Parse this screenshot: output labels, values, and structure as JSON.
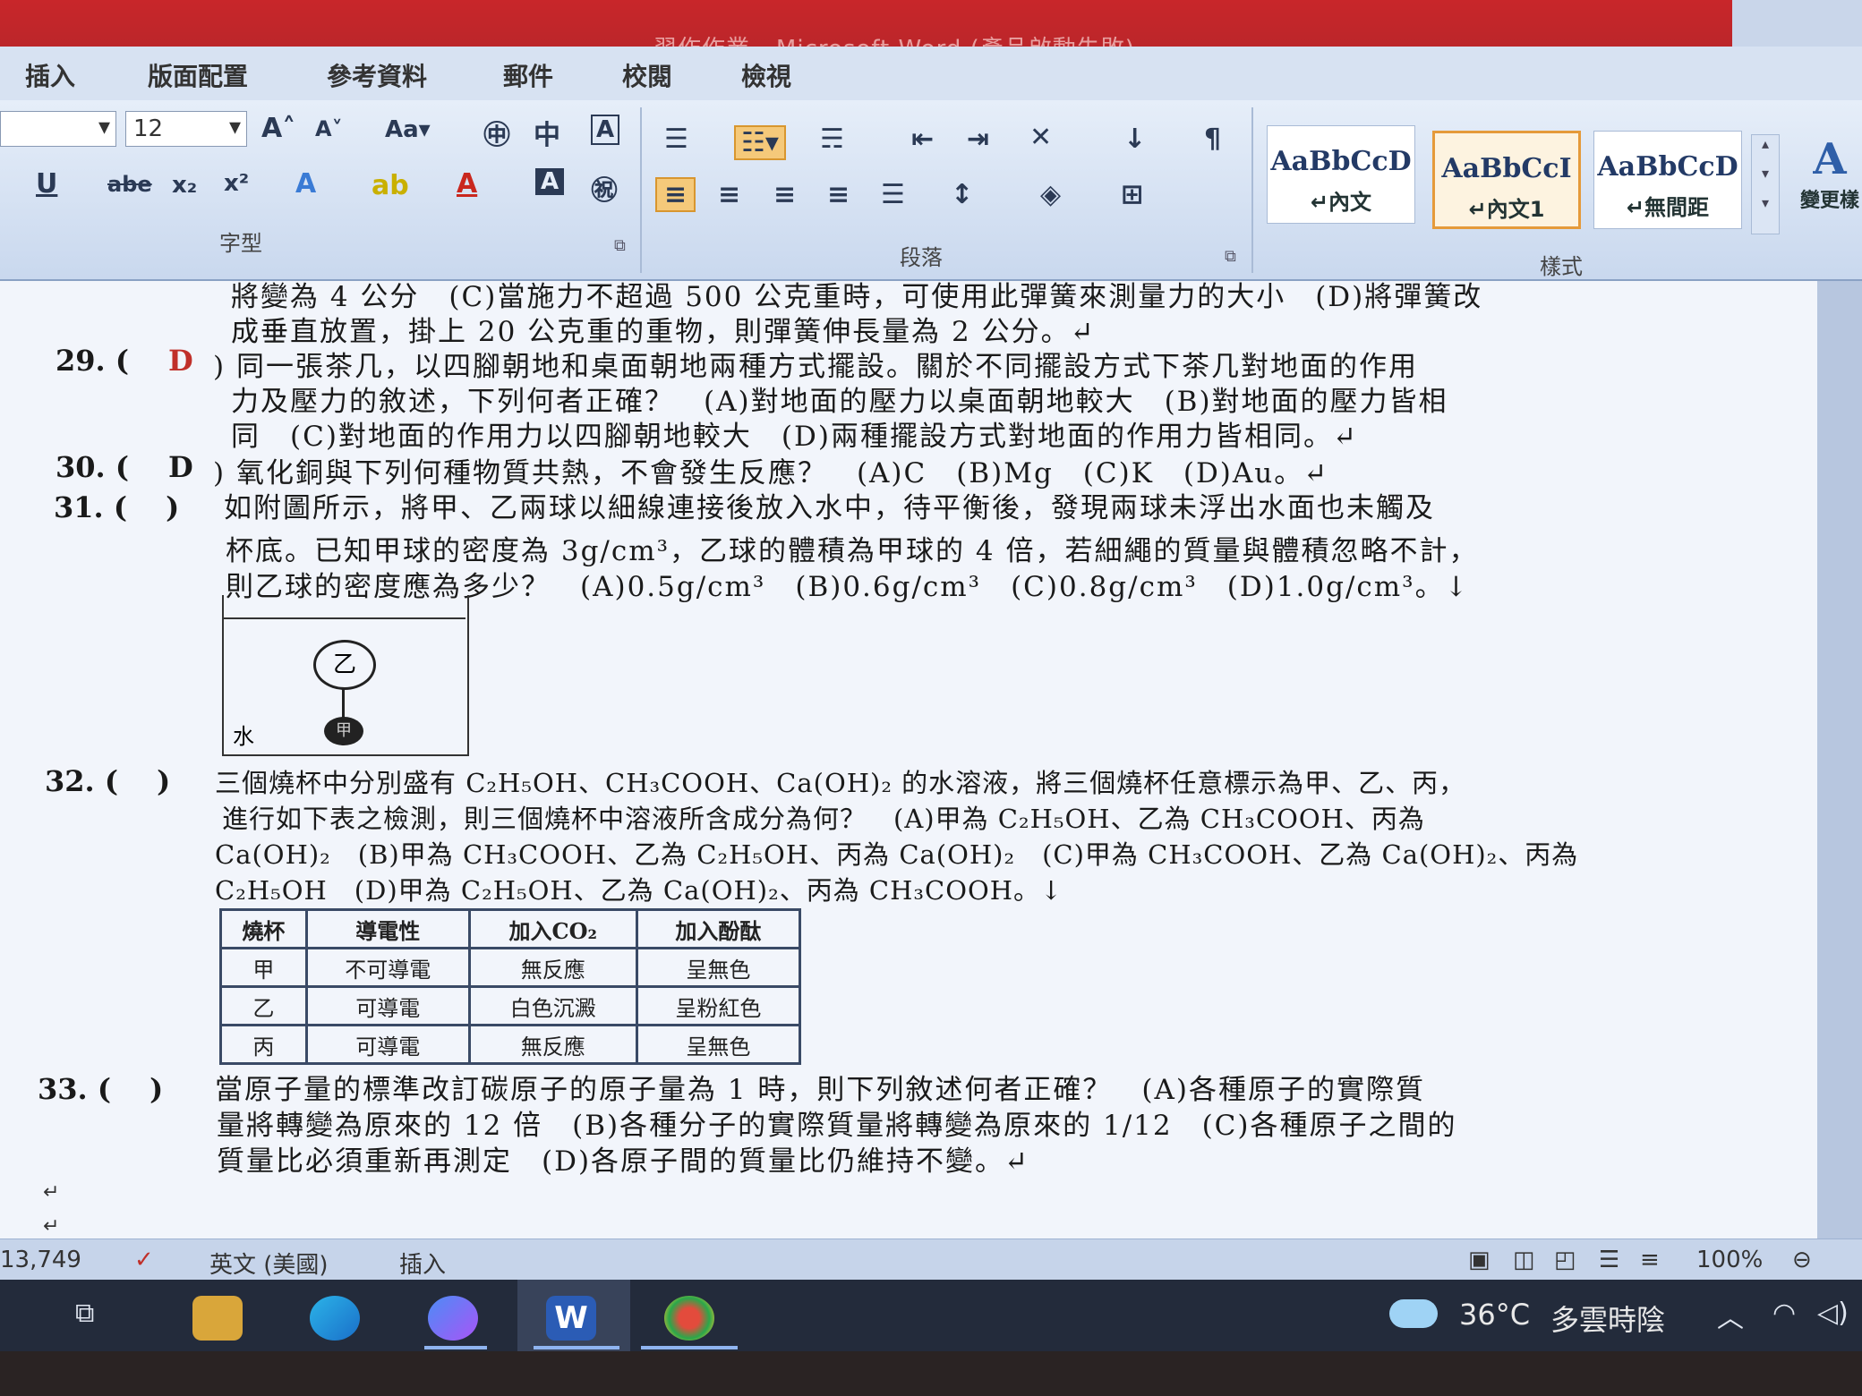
{
  "window": {
    "title": "習作作業 - Microsoft Word (產品啟動失敗)"
  },
  "ribbon": {
    "tabs": [
      "插入",
      "版面配置",
      "參考資料",
      "郵件",
      "校閱",
      "檢視"
    ],
    "font_size": "12",
    "groups": {
      "font": "字型",
      "paragraph": "段落",
      "styles": "樣式"
    },
    "styles": [
      {
        "sample": "AaBbCcD",
        "name": "↵內文"
      },
      {
        "sample": "AaBbCcI",
        "name": "↵內文1"
      },
      {
        "sample": "AaBbCcD",
        "name": "↵無間距"
      }
    ],
    "change_styles": "變更樣"
  },
  "document": {
    "q28_line1": "將變為 4 公分　(C)當施力不超過 500 公克重時，可使用此彈簧來測量力的大小　(D)將彈簧改",
    "q28_line2": "成垂直放置，掛上 20 公克重的重物，則彈簧伸長量為 2 公分。↵",
    "q29_num": "29. (",
    "q29_ans": "D",
    "q29_line1": ") 同一張茶几，以四腳朝地和桌面朝地兩種方式擺設。關於不同擺設方式下茶几對地面的作用",
    "q29_line2": "力及壓力的敘述，下列何者正確？　(A)對地面的壓力以桌面朝地較大　(B)對地面的壓力皆相",
    "q29_line3": "同　(C)對地面的作用力以四腳朝地較大　(D)兩種擺設方式對地面的作用力皆相同。↵",
    "q30_num": "30. (",
    "q30_ans": "D",
    "q30_line1": ") 氧化銅與下列何種物質共熱，不會發生反應？　(A)C　(B)Mg　(C)K　(D)Au。↵",
    "q31_num": "31. (　 )",
    "q31_line1": "如附圖所示，將甲、乙兩球以細線連接後放入水中，待平衡後，發現兩球未浮出水面也未觸及",
    "q31_line2": "杯底。已知甲球的密度為 3g/cm³，乙球的體積為甲球的 4 倍，若細繩的質量與體積忽略不計，",
    "q31_line3": "則乙球的密度應為多少？　(A)0.5g/cm³　(B)0.6g/cm³　(C)0.8g/cm³　(D)1.0g/cm³。↓",
    "figure": {
      "ball_top": "乙",
      "ball_bottom": "甲",
      "water": "水"
    },
    "q32_num": "32. (　 )",
    "q32_line1": "三個燒杯中分別盛有 C₂H₅OH、CH₃COOH、Ca(OH)₂ 的水溶液，將三個燒杯任意標示為甲、乙、丙，",
    "q32_line2": "進行如下表之檢測，則三個燒杯中溶液所含成分為何？　(A)甲為 C₂H₅OH、乙為 CH₃COOH、丙為",
    "q32_line3": "Ca(OH)₂　(B)甲為 CH₃COOH、乙為 C₂H₅OH、丙為 Ca(OH)₂　(C)甲為 CH₃COOH、乙為 Ca(OH)₂、丙為",
    "q32_line4": "C₂H₅OH　(D)甲為 C₂H₅OH、乙為 Ca(OH)₂、丙為 CH₃COOH。↓",
    "table": {
      "headers": [
        "燒杯",
        "導電性",
        "加入CO₂",
        "加入酚酞"
      ],
      "rows": [
        [
          "甲",
          "不可導電",
          "無反應",
          "呈無色"
        ],
        [
          "乙",
          "可導電",
          "白色沉澱",
          "呈粉紅色"
        ],
        [
          "丙",
          "可導電",
          "無反應",
          "呈無色"
        ]
      ]
    },
    "q33_num": "33. (　 )",
    "q33_line1": "當原子量的標準改訂碳原子的原子量為 1 時，則下列敘述何者正確？　(A)各種原子的實際質",
    "q33_line2": "量將轉變為原來的 12 倍　(B)各種分子的實際質量將轉變為原來的 1/12　(C)各種原子之間的",
    "q33_line3": "質量比必須重新再測定　(D)各原子間的質量比仍維持不變。↵"
  },
  "statusbar": {
    "word_count": "13,749",
    "language": "英文 (美國)",
    "mode": "插入",
    "zoom": "100%"
  },
  "taskbar": {
    "weather": "36°C",
    "weather_desc": "多雲時陰"
  }
}
